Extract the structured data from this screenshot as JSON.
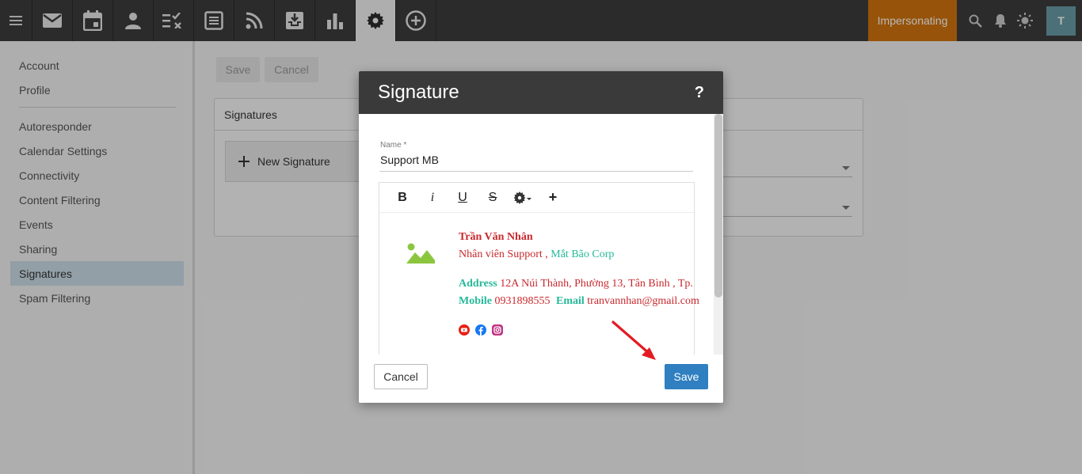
{
  "topbar": {
    "apps": [
      {
        "name": "mail",
        "icon": "mail-icon"
      },
      {
        "name": "calendar",
        "icon": "calendar-icon"
      },
      {
        "name": "contacts",
        "icon": "person-icon"
      },
      {
        "name": "tasks",
        "icon": "tasks-icon"
      },
      {
        "name": "notes",
        "icon": "notes-icon"
      },
      {
        "name": "feeds",
        "icon": "rss-icon"
      },
      {
        "name": "archive",
        "icon": "archive-icon"
      },
      {
        "name": "reports",
        "icon": "bar-chart-icon"
      },
      {
        "name": "settings",
        "icon": "gear-icon"
      },
      {
        "name": "add",
        "icon": "plus-circle-icon"
      }
    ],
    "impersonating_label": "Impersonating",
    "avatar_letter": "T",
    "colors": {
      "bar": "#3c3c3c",
      "impersonating": "#d0730d",
      "avatar": "#6a9ba6"
    }
  },
  "sidebar": {
    "items": [
      {
        "label": "Account"
      },
      {
        "label": "Profile"
      },
      {
        "label": "Autoresponder"
      },
      {
        "label": "Calendar Settings"
      },
      {
        "label": "Connectivity"
      },
      {
        "label": "Content Filtering"
      },
      {
        "label": "Events"
      },
      {
        "label": "Sharing"
      },
      {
        "label": "Signatures",
        "active": true
      },
      {
        "label": "Spam Filtering"
      }
    ]
  },
  "main": {
    "save_label": "Save",
    "cancel_label": "Cancel",
    "card_title": "Signatures",
    "new_signature_label": "New Signature"
  },
  "modal": {
    "title": "Signature",
    "help": "?",
    "name_label": "Name *",
    "name_value": "Support MB",
    "toolbar": {
      "bold": "B",
      "italic": "i",
      "underline": "U",
      "strike": "S",
      "plus": "+"
    },
    "signature": {
      "person_name": "Trần Văn Nhân",
      "role": "Nhân viên Support ,",
      "company": "Mắt Bão Corp",
      "address_label": "Address",
      "address_value": "12A Núi Thành, Phường 13, Tân Bình , Tp.",
      "mobile_label": "Mobile",
      "mobile_value": "0931898555",
      "email_label": "Email",
      "email_value": "tranvannhan@gmail.com"
    },
    "cancel_label": "Cancel",
    "save_label": "Save",
    "colors": {
      "save": "#2f7fc1",
      "red_text": "#c9282d",
      "teal_text": "#26b99a"
    }
  }
}
